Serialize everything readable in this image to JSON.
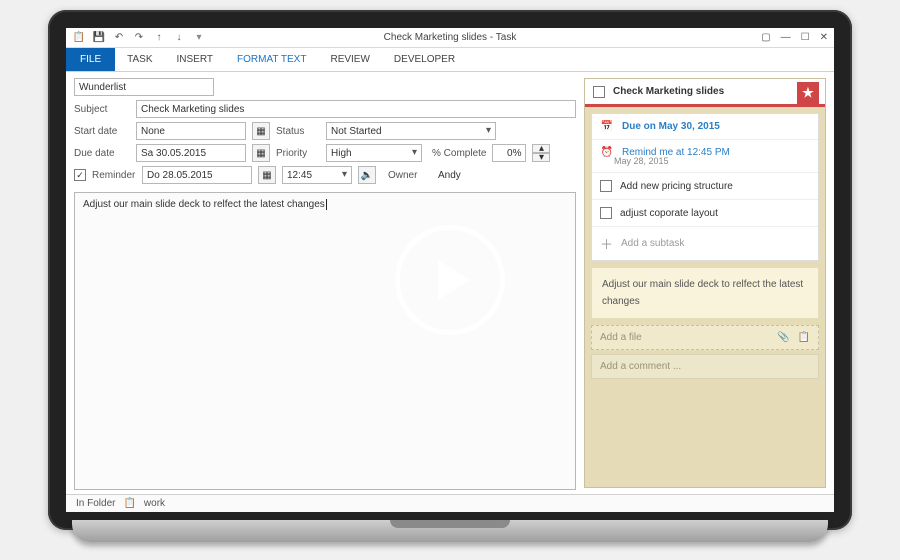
{
  "window": {
    "title": "Check Marketing slides - Task"
  },
  "ribbon": {
    "file": "FILE",
    "tabs": [
      "TASK",
      "INSERT",
      "FORMAT TEXT",
      "REVIEW",
      "DEVELOPER"
    ],
    "active": "FORMAT TEXT"
  },
  "form": {
    "category": {
      "label": "",
      "value": "Wunderlist"
    },
    "subject": {
      "label": "Subject",
      "value": "Check Marketing slides"
    },
    "start_date": {
      "label": "Start date",
      "value": "None"
    },
    "due_date": {
      "label": "Due date",
      "value": "Sa 30.05.2015"
    },
    "status": {
      "label": "Status",
      "value": "Not Started"
    },
    "priority": {
      "label": "Priority",
      "value": "High"
    },
    "pct_complete": {
      "label": "% Complete",
      "value": "0%"
    },
    "reminder": {
      "label": "Reminder",
      "checked": true,
      "date": "Do 28.05.2015",
      "time": "12:45"
    },
    "owner": {
      "label": "Owner",
      "value": "Andy"
    },
    "body": "Adjust our main slide deck to relfect the latest changes"
  },
  "footer": {
    "in_folder_label": "In Folder",
    "folder": "work"
  },
  "side": {
    "title": "Check Marketing slides",
    "due": "Due on May 30, 2015",
    "reminder": "Remind me at 12:45 PM",
    "reminder_date": "May 28, 2015",
    "subtasks": [
      "Add new pricing structure",
      "adjust coporate layout"
    ],
    "add_subtask": "Add a subtask",
    "note": "Adjust our main slide deck to relfect the latest changes",
    "add_file": "Add a file",
    "add_comment": "Add a comment ..."
  },
  "icons": {
    "save": "💾",
    "undo": "↶",
    "redo": "↷",
    "up": "↑",
    "down": "↓",
    "calendar": "📅",
    "alarm": "⏰",
    "attach": "📎",
    "clip": "📋",
    "star": "★",
    "speaker": "🔈"
  }
}
